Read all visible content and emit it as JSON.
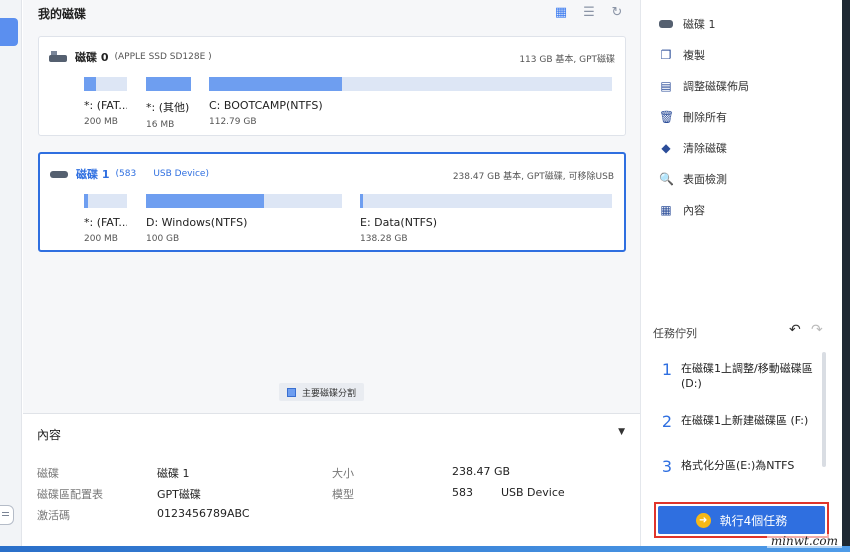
{
  "main": {
    "title": "我的磁碟",
    "view_icons": [
      "grid-view-icon",
      "list-view-icon",
      "refresh-icon"
    ]
  },
  "disks": [
    {
      "name": "磁碟 0",
      "model": "(APPLE SSD SD128E )",
      "info": "113 GB 基本, GPT磁碟",
      "partitions": [
        {
          "label": "*: (FAT...",
          "size": "200 MB",
          "used_fraction": 0.27
        },
        {
          "label": "*: (其他)",
          "size": "16 MB",
          "used_fraction": 1.0
        },
        {
          "label": "C: BOOTCAMP(NTFS)",
          "size": "112.79 GB",
          "used_fraction": 0.33
        }
      ]
    },
    {
      "name": "磁碟 1",
      "model": "(583      USB Device)",
      "info": "238.47 GB 基本, GPT磁碟, 可移除USB",
      "partitions": [
        {
          "label": "*: (FAT...",
          "size": "200 MB",
          "used_fraction": 0.1
        },
        {
          "label": "D: Windows(NTFS)",
          "size": "100 GB",
          "used_fraction": 0.6
        },
        {
          "label": "E: Data(NTFS)",
          "size": "138.28 GB",
          "used_fraction": 0.01
        }
      ]
    }
  ],
  "legend": {
    "primary": "主要磁碟分割"
  },
  "properties": {
    "title": "內容",
    "rows": [
      {
        "k1": "磁碟",
        "v1": "磁碟 1",
        "k2": "大小",
        "v2": "238.47 GB"
      },
      {
        "k1": "磁碟區配置表",
        "v1": "GPT磁碟",
        "k2": "模型",
        "v2": "583        USB Device"
      },
      {
        "k1": "激活碼",
        "v1": "0123456789ABC",
        "k2": "",
        "v2": ""
      }
    ]
  },
  "right": {
    "header": "磁碟 1",
    "menu": [
      "複製",
      "調整磁碟佈局",
      "刪除所有",
      "清除磁碟",
      "表面檢測",
      "內容"
    ],
    "task_title": "任務佇列",
    "tasks": [
      {
        "num": "1",
        "text": "在磁碟1上調整/移動磁碟區(D:)"
      },
      {
        "num": "2",
        "text": "在磁碟1上新建磁碟區 (F:)"
      },
      {
        "num": "3",
        "text": "格式化分區(E:)為NTFS"
      }
    ],
    "execute": "執行4個任務"
  },
  "watermark": "minwt.com",
  "colors": {
    "accent": "#2f6fe0",
    "bar_fill": "#6e9ef0",
    "bar_empty": "#dde6f5",
    "highlight": "#e0342b",
    "arrow": "#f6b817"
  }
}
